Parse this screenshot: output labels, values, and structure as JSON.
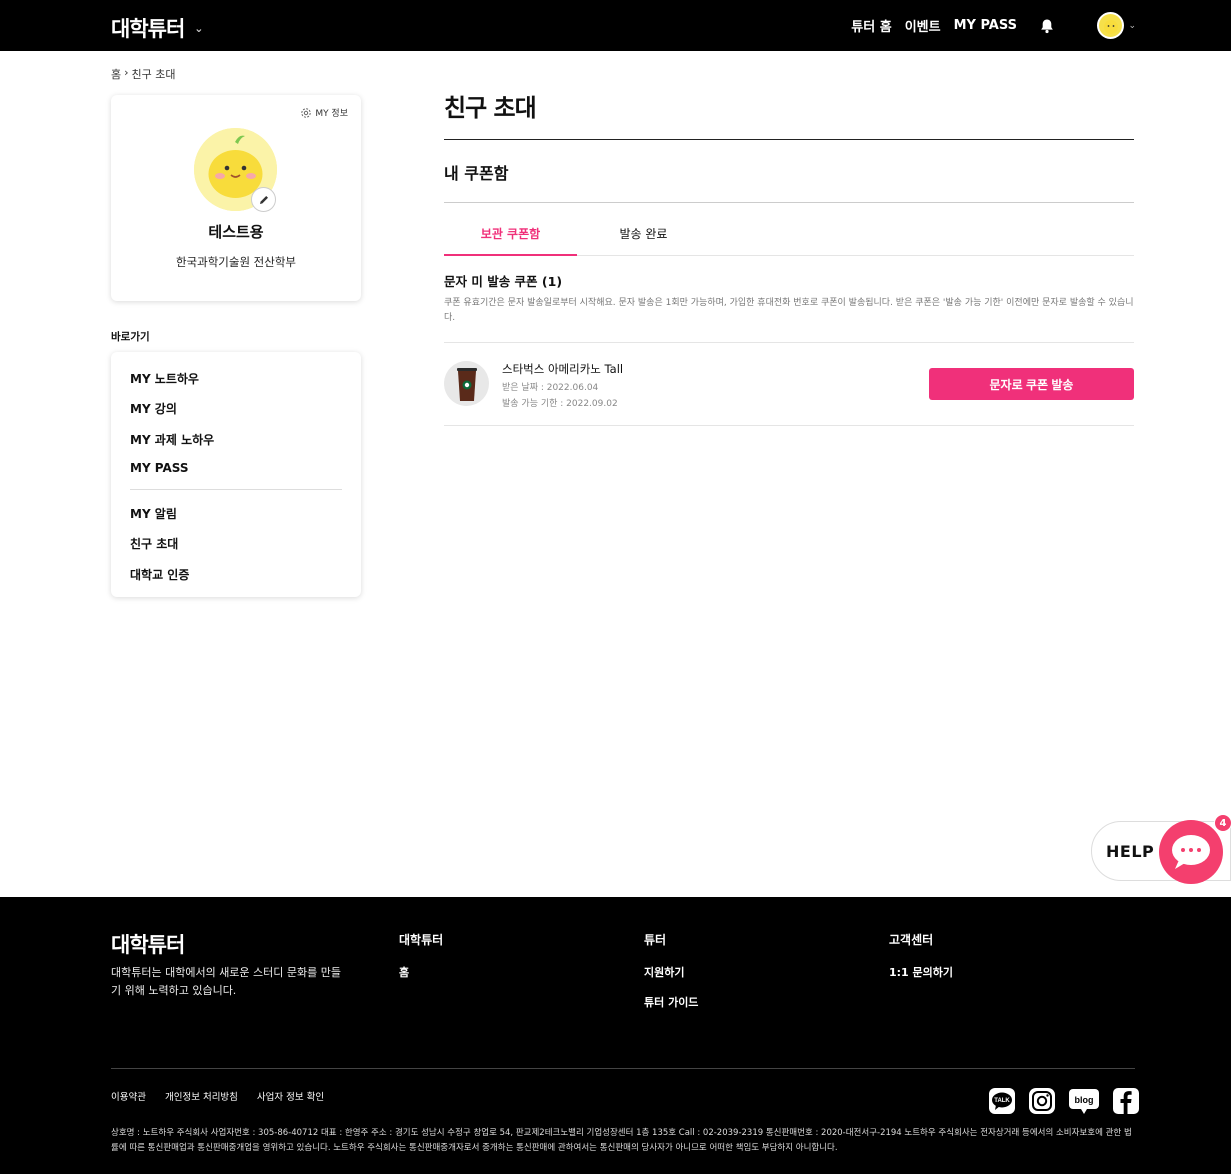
{
  "header": {
    "logo": "대학튜터",
    "nav": [
      "튜터 홈",
      "이벤트",
      "MY PASS"
    ]
  },
  "breadcrumb": {
    "home": "홈",
    "current": "친구 초대"
  },
  "profile": {
    "myinfo": "MY 정보",
    "name": "테스트용",
    "dept": "한국과학기술원 전산학부"
  },
  "sidebar": {
    "title": "바로가기",
    "items": [
      "MY 노트하우",
      "MY 강의",
      "MY 과제 노하우",
      "MY PASS",
      "MY 알림",
      "친구 초대",
      "대학교 인증"
    ]
  },
  "main": {
    "title": "친구 초대",
    "subtitle": "내 쿠폰함",
    "tabs": [
      "보관 쿠폰함",
      "발송 완료"
    ],
    "section_title": "문자 미 발송 쿠폰 (1)",
    "description": "쿠폰 유효기간은 문자 발송일로부터 시작해요. 문자 발송은 1회만 가능하며, 가입한 휴대전화 번호로 쿠폰이 발송됩니다. 받은 쿠폰은 '발송 가능 기한' 이전에만 문자로 발송할 수 있습니다.",
    "coupon": {
      "name": "스타벅스 아메리카노 Tall",
      "received": "받은 날짜 : 2022.06.04",
      "limit": "발송 가능 기한 : 2022.09.02",
      "button": "문자로 쿠폰 발송"
    }
  },
  "help": {
    "label": "HELP",
    "badge": "4"
  },
  "footer": {
    "logo": "대학튜터",
    "intro": "대학튜터는 대학에서의 새로운 스터디 문화를 만들기 위해 노력하고 있습니다.",
    "col1": {
      "title": "대학튜터",
      "links": [
        "홈"
      ]
    },
    "col2": {
      "title": "튜터",
      "links": [
        "지원하기",
        "튜터 가이드"
      ]
    },
    "col3": {
      "title": "고객센터",
      "links": [
        "1:1 문의하기"
      ]
    },
    "bottom_links": [
      "이용약관",
      "개인정보 처리방침",
      "사업자 정보 확인"
    ],
    "legal": "상호명 : 노트하우 주식회사 사업자번호 : 305-86-40712 대표 : 한영주 주소 : 경기도 성남시 수정구 창업로 54, 판교제2테크노밸리 기업성장센터 1층 135호 Call : 02-2039-2319 통신판매번호 : 2020-대전서구-2194 노트하우 주식회사는 전자상거래 등에서의 소비자보호에 관한 법률에 따른 통신판매업과 통신판매중개업을 영위하고 있습니다. 노트하우 주식회사는 통신판매중개자로서 중개하는 통신판매에 관하여서는 통신판매의 당사자가 아니므로 어떠한 책임도 부담하지 아니합니다.",
    "social_blog": "blog"
  },
  "colors": {
    "accent": "#f0307a",
    "header_bg": "#000000"
  }
}
